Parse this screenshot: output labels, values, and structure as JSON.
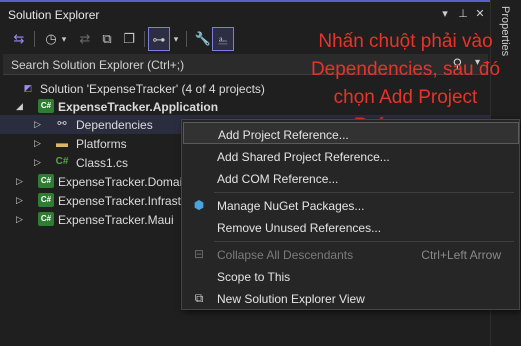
{
  "window": {
    "title": "Solution Explorer"
  },
  "sidebar": {
    "label": "Properties"
  },
  "search": {
    "placeholder": "Search Solution Explorer (Ctrl+;)"
  },
  "tree": {
    "solution": "Solution 'ExpenseTracker' (4 of 4 projects)",
    "project_app": "ExpenseTracker.Application",
    "dependencies": "Dependencies",
    "platforms": "Platforms",
    "class1": "Class1.cs",
    "project_domain": "ExpenseTracker.Domain",
    "project_infra": "ExpenseTracker.Infrastru",
    "project_maui": "ExpenseTracker.Maui"
  },
  "annotation": {
    "text": "Nhấn chuột phải vào Dependencies, sau đó chọn Add Project Reference..."
  },
  "context_menu": {
    "add_project_reference": "Add Project Reference...",
    "add_shared_project_reference": "Add Shared Project Reference...",
    "add_com_reference": "Add COM Reference...",
    "manage_nuget": "Manage NuGet Packages...",
    "remove_unused": "Remove Unused References...",
    "collapse_all": "Collapse All Descendants",
    "collapse_all_shortcut": "Ctrl+Left Arrow",
    "scope_to_this": "Scope to This",
    "new_view": "New Solution Explorer View"
  },
  "colors": {
    "accent": "#5b5fc7",
    "annotation": "#e8332a",
    "csharp": "#2e7d32"
  }
}
